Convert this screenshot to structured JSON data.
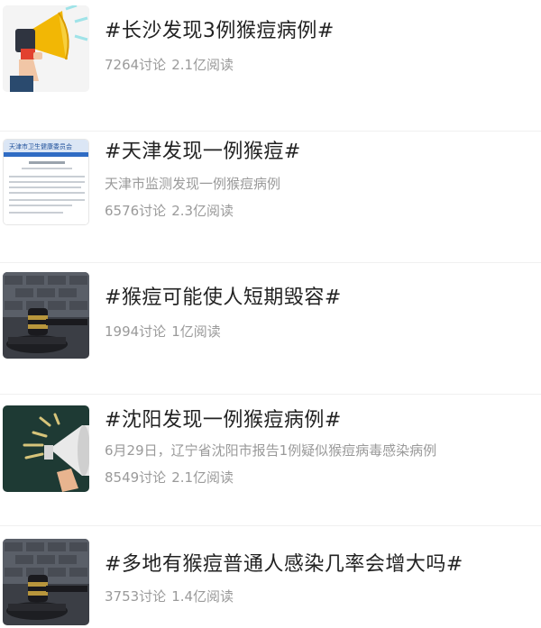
{
  "topics": [
    {
      "title": "#长沙发现3例猴痘病例#",
      "description": "",
      "discussions": "7264讨论",
      "reads": "2.1亿阅读",
      "thumbnail": "megaphone-hand-icon"
    },
    {
      "title": "#天津发现一例猴痘#",
      "description": "天津市监测发现一例猴痘病例",
      "discussions": "6576讨论",
      "reads": "2.3亿阅读",
      "thumbnail": "document-screenshot",
      "thumbnail_header": "天津市卫生健康委员会"
    },
    {
      "title": "#猴痘可能使人短期毁容#",
      "description": "",
      "discussions": "1994讨论",
      "reads": "1亿阅读",
      "thumbnail": "gavel-icon"
    },
    {
      "title": "#沈阳发现一例猴痘病例#",
      "description": "6月29日，辽宁省沈阳市报告1例疑似猴痘病毒感染病例",
      "discussions": "8549讨论",
      "reads": "2.1亿阅读",
      "thumbnail": "megaphone-icon"
    },
    {
      "title": "#多地有猴痘普通人感染几率会增大吗#",
      "description": "",
      "discussions": "3753讨论",
      "reads": "1.4亿阅读",
      "thumbnail": "gavel-icon"
    }
  ],
  "colors": {
    "title": "#222222",
    "meta": "#9a9a9a",
    "divider": "#f0f0f0"
  }
}
